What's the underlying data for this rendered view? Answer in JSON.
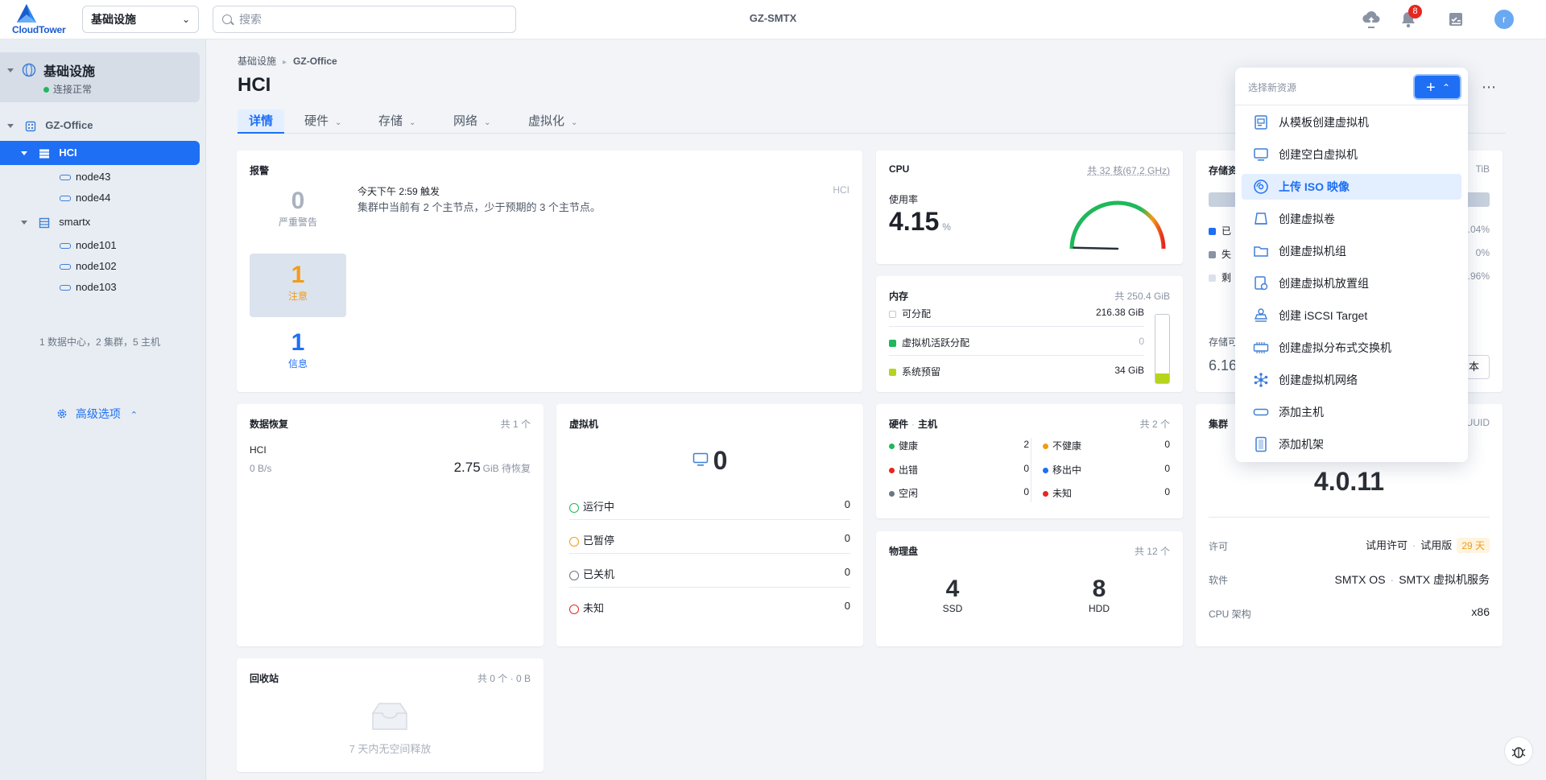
{
  "topbar": {
    "logo_text": "CloudTower",
    "scope_select": "基础设施",
    "search_placeholder": "搜索",
    "cluster_name": "GZ-SMTX",
    "notification_count": "8",
    "avatar_letter": "r"
  },
  "sidebar": {
    "root_label": "基础设施",
    "root_status": "连接正常",
    "datacenter": "GZ-Office",
    "cluster_hci": "HCI",
    "hci_nodes": [
      "node43",
      "node44"
    ],
    "cluster_smartx": "smartx",
    "smartx_nodes": [
      "node101",
      "node102",
      "node103"
    ],
    "summary": "1 数据中心，2 集群，5 主机",
    "advanced": "高级选项"
  },
  "breadcrumb": {
    "root": "基础设施",
    "current": "GZ-Office"
  },
  "page_title": "HCI",
  "tabs": {
    "details": "详情",
    "hardware": "硬件",
    "storage": "存储",
    "network": "网络",
    "virtualization": "虚拟化"
  },
  "alarms": {
    "title": "报警",
    "critical_count": "0",
    "critical_label": "严重警告",
    "notice_count": "1",
    "notice_label": "注意",
    "info_count": "1",
    "info_label": "信息",
    "event_time": "今天下午 2:59 触发",
    "event_text": "集群中当前有 2 个主节点，少于预期的 3 个主节点。",
    "event_source": "HCI"
  },
  "cpu": {
    "title": "CPU",
    "meta": "共 32 核(67.2 GHz)",
    "usage_label": "使用率",
    "usage_value": "4.15",
    "usage_unit": "%",
    "usage_fraction": 0.0415
  },
  "memory": {
    "title": "内存",
    "meta": "共 250.4 GiB",
    "rows": [
      {
        "label": "可分配",
        "value": "216.38 GiB"
      },
      {
        "label": "虚拟机活跃分配",
        "value": "0"
      },
      {
        "label": "系统预留",
        "value": "34 GiB"
      }
    ]
  },
  "storage": {
    "title": "存储资",
    "meta": "TiB",
    "rows": [
      {
        "label": "已",
        "value": ".04%"
      },
      {
        "label": "失",
        "value": "0%"
      },
      {
        "label": "剩",
        "value": ".96%"
      }
    ],
    "capacity_label": "存储可",
    "capacity_value": "6.16",
    "button_tail": "本"
  },
  "recovery": {
    "title": "数据恢复",
    "meta": "共 1 个",
    "cluster": "HCI",
    "speed": "0 B/s",
    "amount": "2.75",
    "amount_unit": "GiB 待恢复"
  },
  "vms": {
    "title": "虚拟机",
    "total": "0",
    "rows": [
      {
        "label": "运行中",
        "value": "0"
      },
      {
        "label": "已暂停",
        "value": "0"
      },
      {
        "label": "已关机",
        "value": "0"
      },
      {
        "label": "未知",
        "value": "0"
      }
    ]
  },
  "hardware": {
    "title": "硬件",
    "subtitle": "主机",
    "meta": "共 2 个",
    "left": [
      {
        "label": "健康",
        "value": "2"
      },
      {
        "label": "出错",
        "value": "0"
      },
      {
        "label": "空闲",
        "value": "0"
      }
    ],
    "right": [
      {
        "label": "不健康",
        "value": "0"
      },
      {
        "label": "移出中",
        "value": "0"
      },
      {
        "label": "未知",
        "value": "0"
      }
    ]
  },
  "disks": {
    "title": "物理盘",
    "meta": "共 12 个",
    "ssd_count": "4",
    "ssd_label": "SSD",
    "hdd_count": "8",
    "hdd_label": "HDD"
  },
  "cluster_info": {
    "title": "集群",
    "meta": "UUID",
    "version": "4.0.11",
    "license_label": "许可",
    "license_value": "试用许可",
    "license_edition": "试用版",
    "license_days": "29 天",
    "software_label": "软件",
    "software_value": "SMTX OS",
    "software_service": "SMTX 虚拟机服务",
    "arch_label": "CPU 架构",
    "arch_value": "x86"
  },
  "recycle": {
    "title": "回收站",
    "meta": "共 0 个 · 0 B",
    "empty_text": "7 天内无空间释放"
  },
  "create_menu": {
    "header": "选择新资源",
    "items": [
      "从模板创建虚拟机",
      "创建空白虚拟机",
      "上传 ISO 映像",
      "创建虚拟卷",
      "创建虚拟机组",
      "创建虚拟机放置组",
      "创建 iSCSI Target",
      "创建虚拟分布式交换机",
      "创建虚拟机网络",
      "添加主机",
      "添加机架"
    ]
  },
  "colors": {
    "primary": "#1e6ff4",
    "warning": "#f29b18",
    "success": "#1fb85a",
    "danger": "#e5271f",
    "reserved": "#b6d41c"
  }
}
